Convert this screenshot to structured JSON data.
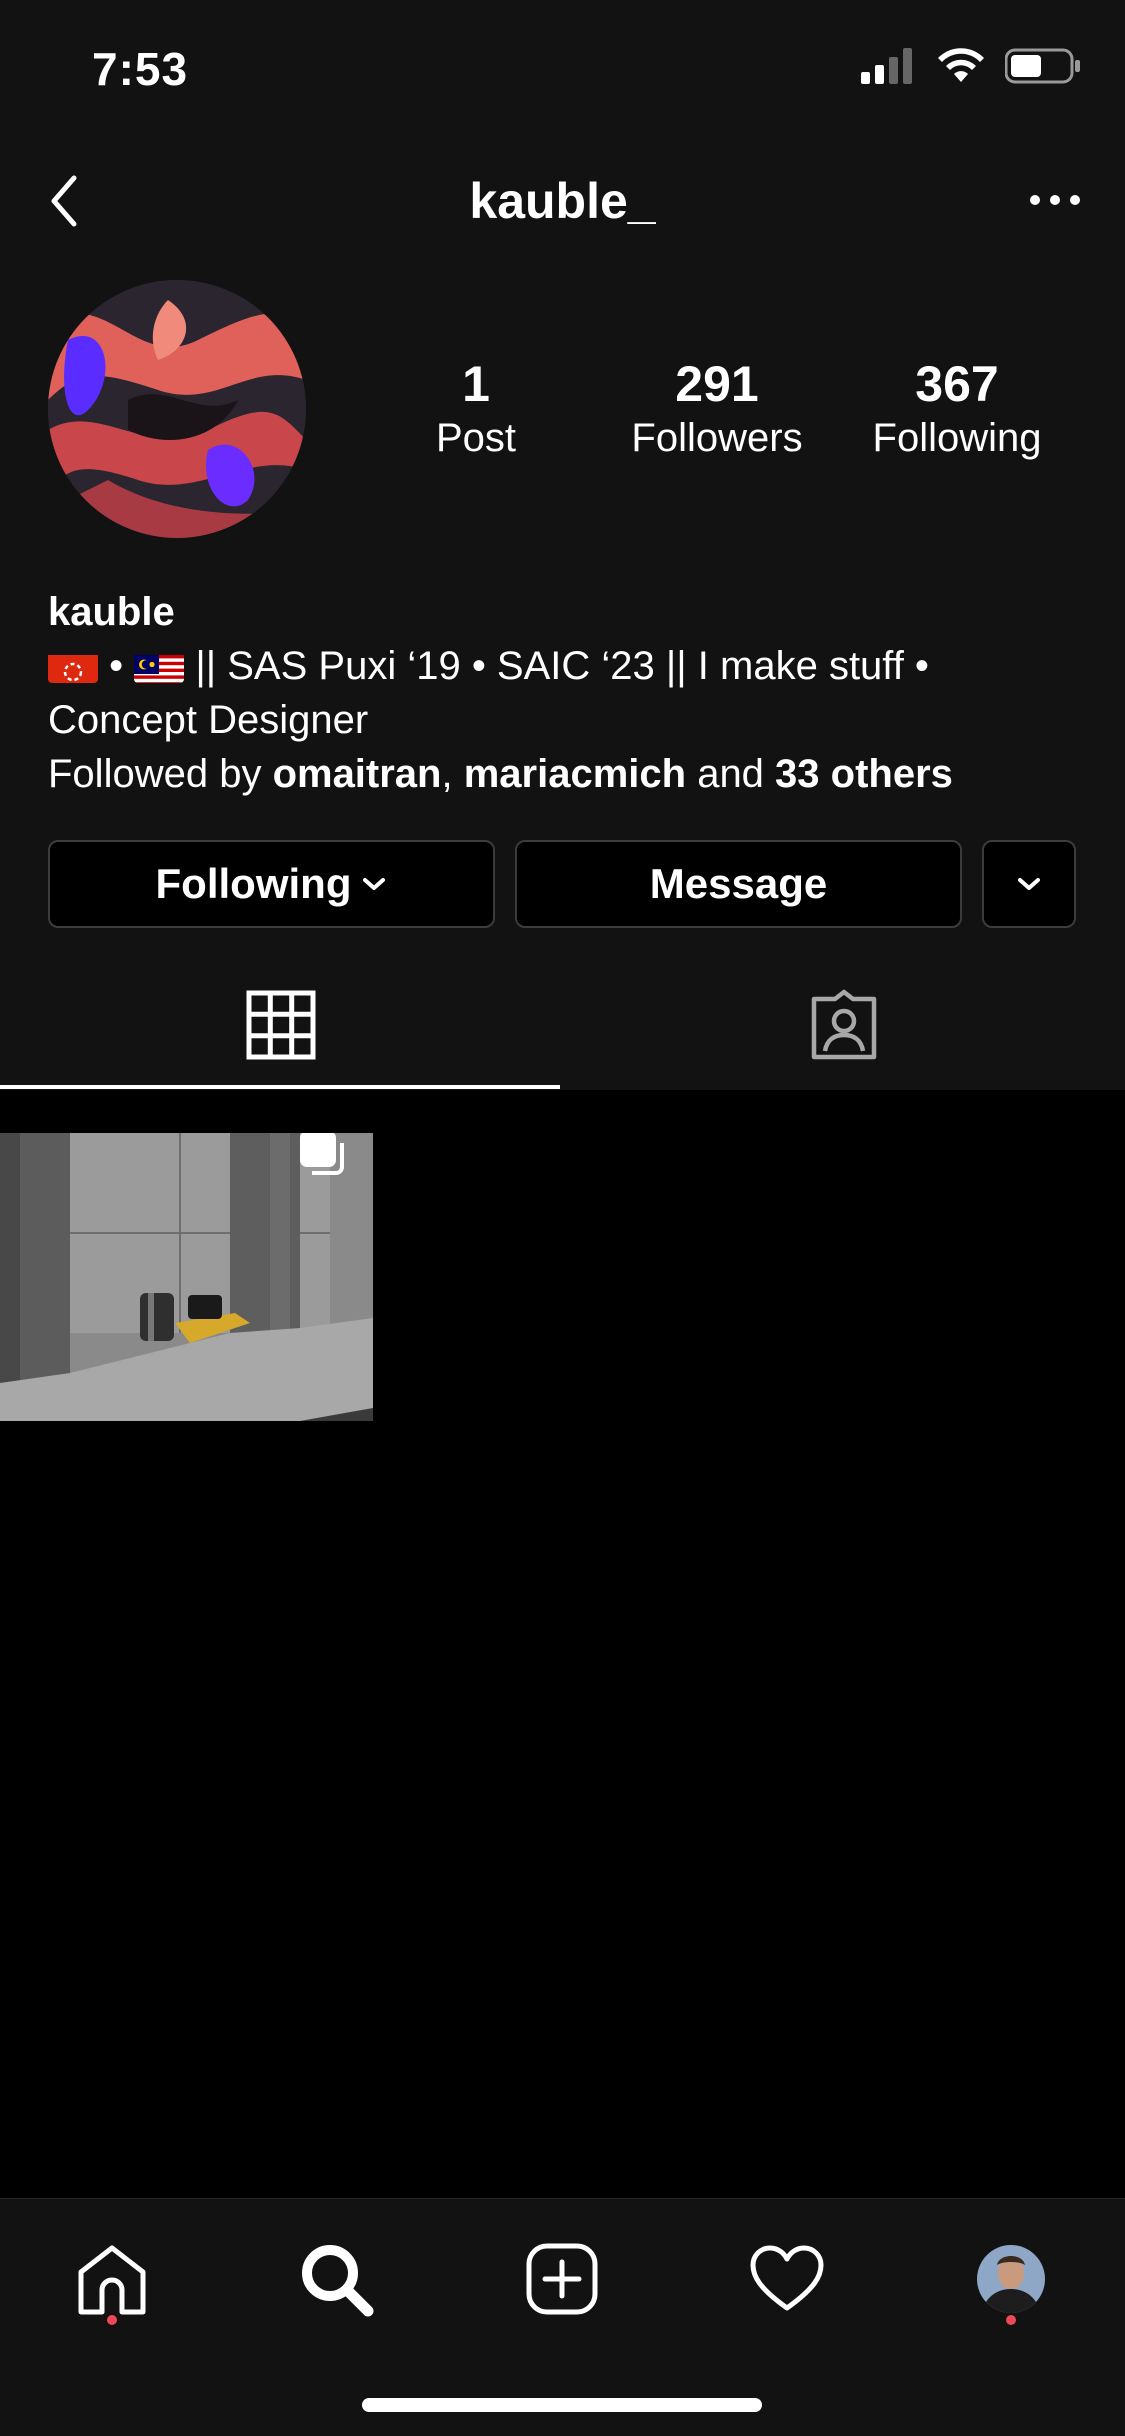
{
  "status_bar": {
    "time": "7:53"
  },
  "header": {
    "title": "kauble_"
  },
  "stats": [
    {
      "value": "1",
      "label": "Post"
    },
    {
      "value": "291",
      "label": "Followers"
    },
    {
      "value": "367",
      "label": "Following"
    }
  ],
  "bio": {
    "name": "kauble",
    "line1": " • ",
    "line1b": " || SAS Puxi ‘19 • SAIC ‘23 || I make stuff •",
    "line2": "Concept Designer",
    "followed_prefix": "Followed by ",
    "followed_user1": "omaitran",
    "followed_sep": ", ",
    "followed_user2": "mariacmich",
    "followed_and": " and ",
    "followed_others": "33 others"
  },
  "actions": {
    "following_label": "Following",
    "message_label": "Message"
  },
  "colors": {
    "background": "#121212",
    "grid_background": "#000000",
    "notification_dot": "#ed4956",
    "button_border": "#3c3c3c"
  },
  "icons": {
    "back": "chevron-left-icon",
    "more": "more-horizontal-icon",
    "grid_tab": "grid-icon",
    "tagged_tab": "tagged-person-icon",
    "multi_post": "carousel-icon",
    "nav": [
      "home-icon",
      "search-icon",
      "add-post-icon",
      "heart-icon",
      "profile-avatar"
    ]
  }
}
